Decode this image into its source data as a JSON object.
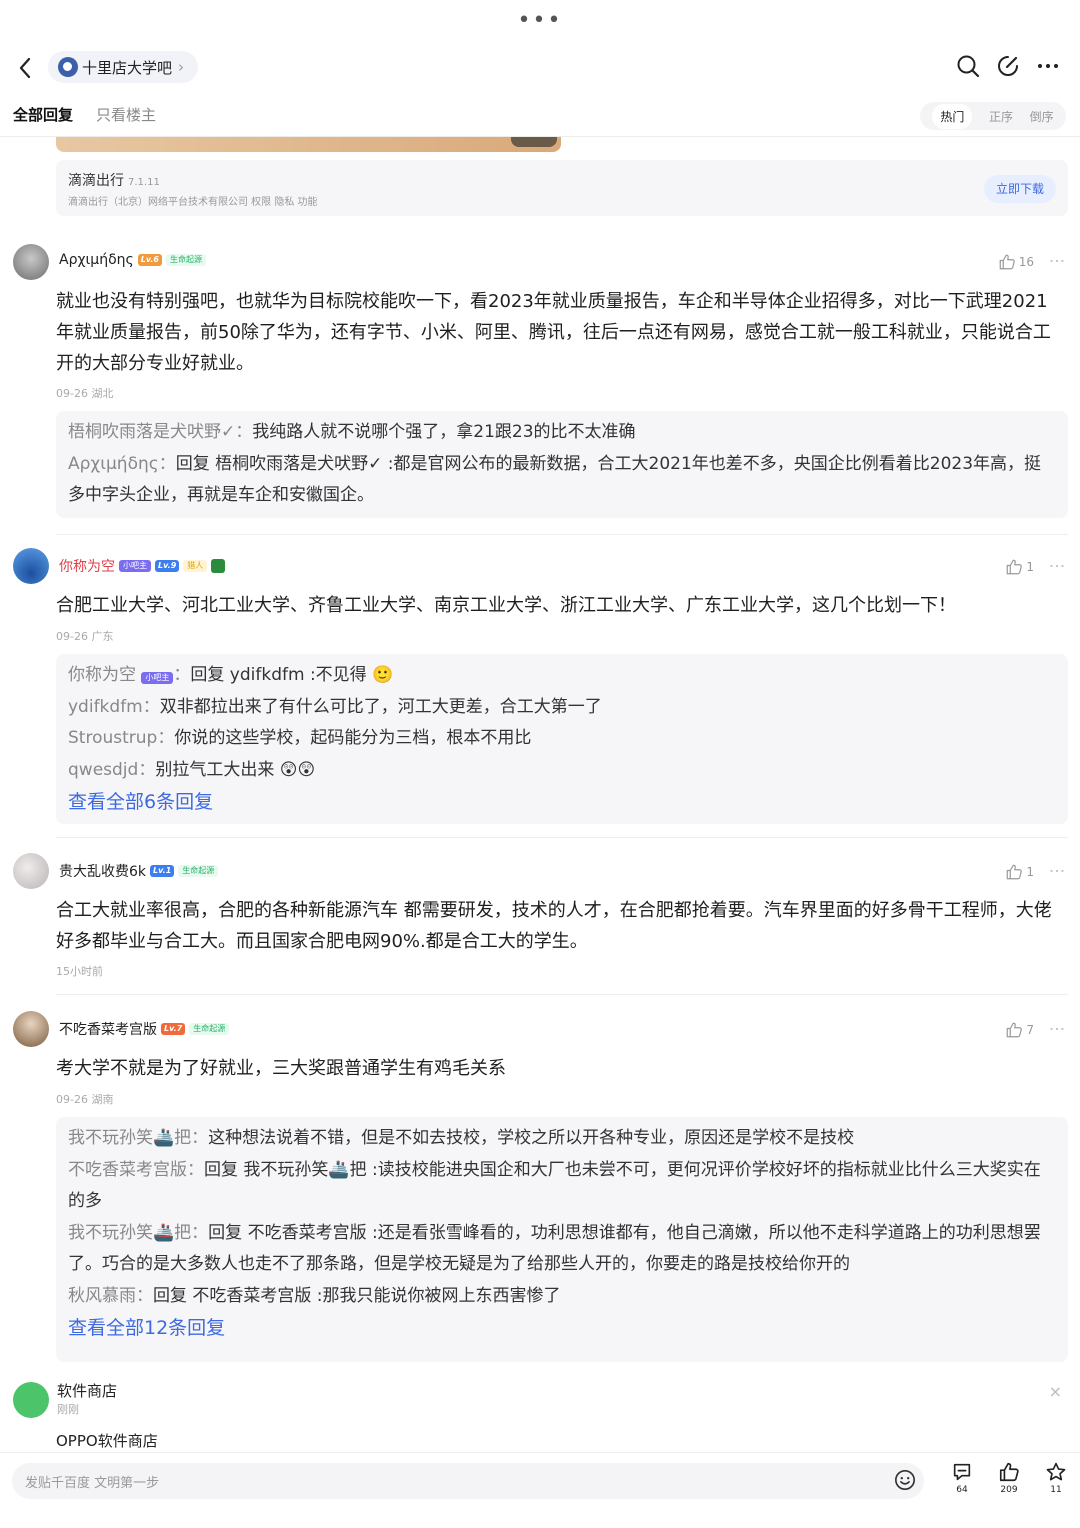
{
  "nav": {
    "forum": "十里店大学吧",
    "chevron": "›"
  },
  "tabs": {
    "all": "全部回复",
    "op_only": "只看楼主",
    "sort": [
      "热门",
      "正序",
      "倒序"
    ]
  },
  "ad": {
    "app": "滴滴出行",
    "version": "7.1.11",
    "company": "滴滴出行（北京）网络平台技术有限公司   权限   隐私   功能",
    "download": "立即下载"
  },
  "posts": [
    {
      "user": "Αρχιμήδης",
      "level": "Lv.6",
      "badge": "生命起源",
      "likes": "16",
      "body": "就业也没有特别强吧，也就华为目标院校能吹一下，看2023年就业质量报告，车企和半导体企业招得多，对比一下武理2021年就业质量报告，前50除了华为，还有字节、小米、阿里、腾讯，往后一点还有网易，感觉合工就一般工科就业，只能说合工开的大部分专业好就业。",
      "time": "09-26  湖北",
      "replies": [
        {
          "name": "梧桐吹雨落是犬吠野✓",
          "text": "我纯路人就不说哪个强了，拿21跟23的比不太准确"
        },
        {
          "name": "Αρχιμήδης",
          "text": "回复 梧桐吹雨落是犬吠野✓ :都是官网公布的最新数据，合工大2021年也差不多，央国企比例看着比2023年高，挺多中字头企业，再就是车企和安徽国企。"
        }
      ]
    },
    {
      "user": "你称为空",
      "tag": "小吧主",
      "level": "Lv.9",
      "badge": "猎人",
      "likes": "1",
      "body": "合肥工业大学、河北工业大学、齐鲁工业大学、南京工业大学、浙江工业大学、广东工业大学，这几个比划一下！",
      "time": "09-26  广东",
      "replies": [
        {
          "name": "你称为空",
          "tag": "小吧主",
          "text": "回复 ydifkdfm :不见得 🙂"
        },
        {
          "name": "ydifkdfm",
          "text": "双非都拉出来了有什么可比了，河工大更差，合工大第一了"
        },
        {
          "name": "Stroustrup",
          "text": "你说的这些学校，起码能分为三档，根本不用比"
        },
        {
          "name": "qwesdjd",
          "text": "别拉气工大出来 😲😲"
        }
      ],
      "view_all": "查看全部6条回复"
    },
    {
      "user": "贵大乱收费6k",
      "level": "Lv.1",
      "badge": "生命起源",
      "likes": "1",
      "body": "合工大就业率很高，合肥的各种新能源汽车 都需要研发，技术的人才，在合肥都抢着要。汽车界里面的好多骨干工程师，大佬好多都毕业与合工大。而且国家合肥电网90%.都是合工大的学生。",
      "time": "15小时前"
    },
    {
      "user": "不吃香菜考宫版",
      "level": "Lv.7",
      "badge": "生命起源",
      "likes": "7",
      "body": "考大学不就是为了好就业，三大奖跟普通学生有鸡毛关系",
      "time": "09-26  湖南",
      "replies": [
        {
          "name": "我不玩孙笑🚢把",
          "text": "这种想法说着不错，但是不如去技校，学校之所以开各种专业，原因还是学校不是技校"
        },
        {
          "name": "不吃香菜考宫版",
          "text": "回复 我不玩孙笑🚢把 :读技校能进央国企和大厂也未尝不可，更何况评价学校好坏的指标就业比什么三大奖实在的多"
        },
        {
          "name": "我不玩孙笑🚢把",
          "text": "回复 不吃香菜考宫版 :还是看张雪峰看的，功利思想谁都有，他自己滴嫩，所以他不走科学道路上的功利思想罢了。巧合的是大多数人也走不了那条路，但是学校无疑是为了给那些人开的，你要走的路是技校给你开的"
        },
        {
          "name": "秋风慕雨",
          "text": "回复 不吃香菜考宫版 :那我只能说你被网上东西害惨了"
        }
      ],
      "view_all": "查看全部12条回复"
    }
  ],
  "notice": {
    "title": "软件商店",
    "time": "刚刚",
    "body": "OPPO软件商店",
    "close": "×"
  },
  "bottom": {
    "placeholder": "发贴千百度 文明第一步",
    "comments": "64",
    "likes": "209",
    "stars": "11"
  }
}
